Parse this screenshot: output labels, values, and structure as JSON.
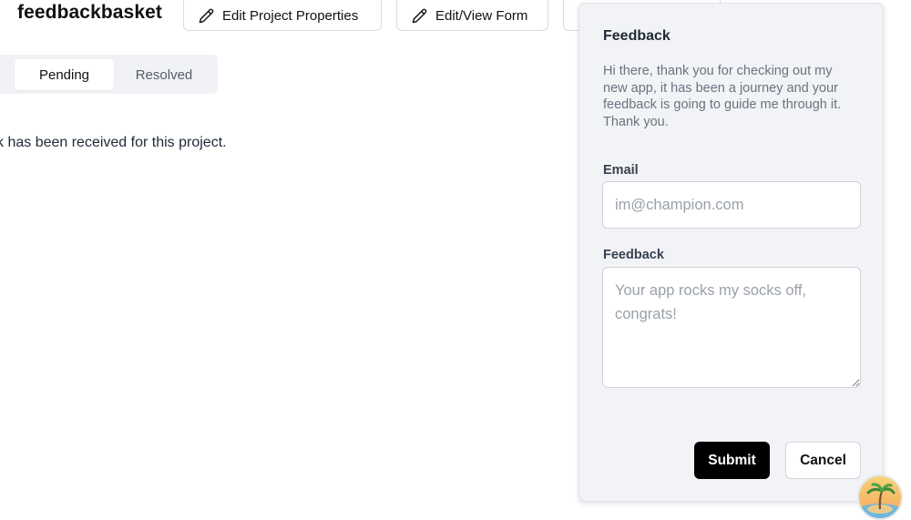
{
  "header": {
    "project_name": "feedbackbasket",
    "edit_properties_label": "Edit Project Properties",
    "edit_form_label": "Edit/View Form"
  },
  "tabs": [
    {
      "label": "Pending",
      "active": true
    },
    {
      "label": "Resolved",
      "active": false
    }
  ],
  "empty_message": "k has been received for this project.",
  "feedback_panel": {
    "title": "Feedback",
    "description": "Hi there, thank you for checking out my new app, it has been a journey and your feedback is going to guide me through it. Thank you.",
    "email_label": "Email",
    "email_value": "",
    "email_placeholder": "im@champion.com",
    "feedback_label": "Feedback",
    "feedback_value": "",
    "feedback_placeholder": "Your app rocks my socks off, congrats!",
    "submit_label": "Submit",
    "cancel_label": "Cancel"
  },
  "icons": {
    "edit": "pencil-icon",
    "avatar": "palm-tree-avatar"
  },
  "colors": {
    "primary_button": "#000000",
    "panel_background": "#f2f3f6",
    "tab_bar_background": "#f1f2f5"
  }
}
